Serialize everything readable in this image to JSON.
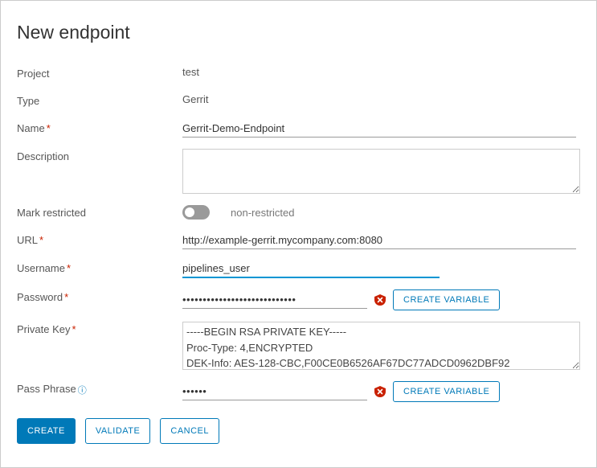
{
  "title": "New endpoint",
  "labels": {
    "project": "Project",
    "type": "Type",
    "name": "Name",
    "description": "Description",
    "mark_restricted": "Mark restricted",
    "url": "URL",
    "username": "Username",
    "password": "Password",
    "private_key": "Private Key",
    "pass_phrase": "Pass Phrase"
  },
  "values": {
    "project": "test",
    "type": "Gerrit",
    "name": "Gerrit-Demo-Endpoint",
    "description": "",
    "restricted_state": "non-restricted",
    "url": "http://example-gerrit.mycompany.com:8080",
    "username": "pipelines_user",
    "password": "••••••••••••••••••••••••••••",
    "private_key": "-----BEGIN RSA PRIVATE KEY-----\nProc-Type: 4,ENCRYPTED\nDEK-Info: AES-128-CBC,F00CE0B6526AF67DC77ADCD0962DBF92",
    "pass_phrase": "••••••"
  },
  "buttons": {
    "create_variable": "CREATE VARIABLE",
    "create": "CREATE",
    "validate": "VALIDATE",
    "cancel": "CANCEL"
  }
}
